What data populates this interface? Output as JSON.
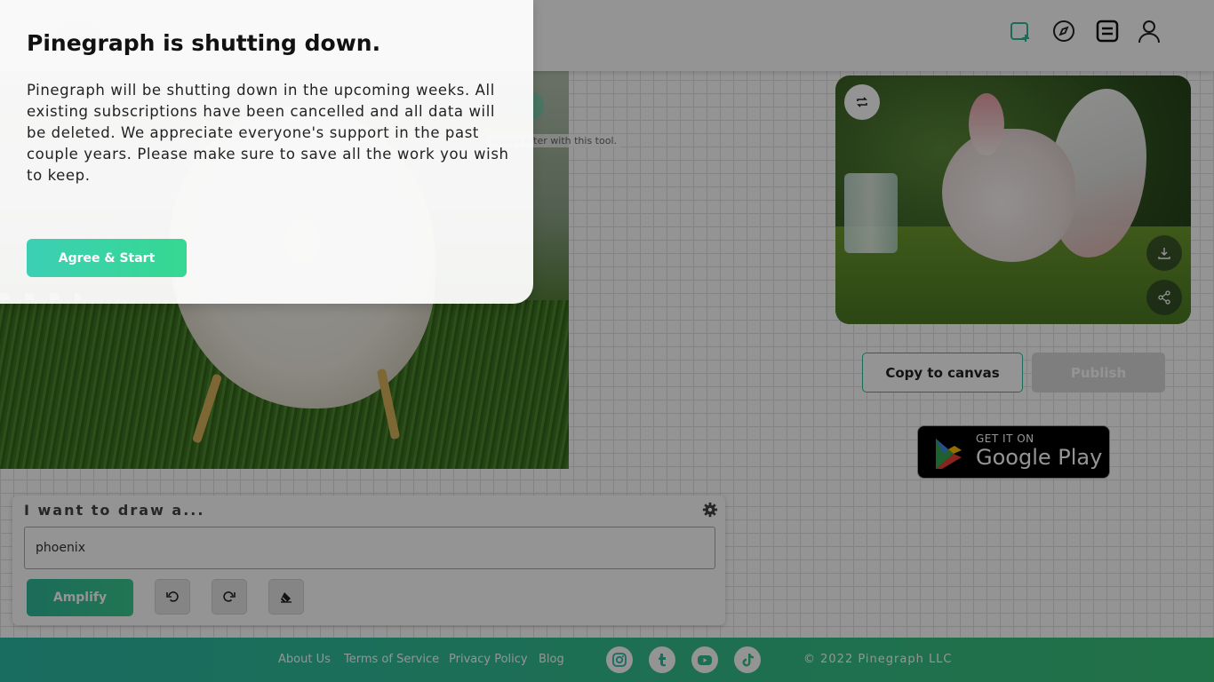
{
  "modal": {
    "title": "Pinegraph is shutting down.",
    "body": "Pinegraph will be shutting down in the upcoming weeks. All existing subscriptions have been cancelled and all data will be deleted. We appreciate everyone's support in the past couple years. Please make sure to save all the work you wish to keep.",
    "agree_label": "Agree & Start"
  },
  "header": {
    "nav_icons": [
      "new-canvas-icon",
      "explore-compass-icon",
      "feed-icon",
      "user-icon"
    ]
  },
  "canvas": {
    "hint_text": "image after with this tool."
  },
  "prompt": {
    "title": "I want to draw a...",
    "input_value": "phoenix",
    "amplify_label": "Amplify"
  },
  "result": {
    "copy_label": "Copy to canvas",
    "publish_label": "Publish"
  },
  "google_play": {
    "small": "GET IT ON",
    "big": "Google Play"
  },
  "footer": {
    "links": [
      "About Us",
      "Terms of Service",
      "Privacy Policy",
      "Blog"
    ],
    "social_icons": [
      "instagram-icon",
      "tumblr-icon",
      "youtube-icon",
      "tiktok-icon"
    ],
    "copyright": "© 2022 Pinegraph LLC"
  },
  "colors": {
    "accent": "#2fb99a",
    "accent_green": "#3acb8f",
    "footer_start": "#2cbba6",
    "footer_end": "#3ac37b",
    "publish_disabled": "#d9d9d9"
  }
}
